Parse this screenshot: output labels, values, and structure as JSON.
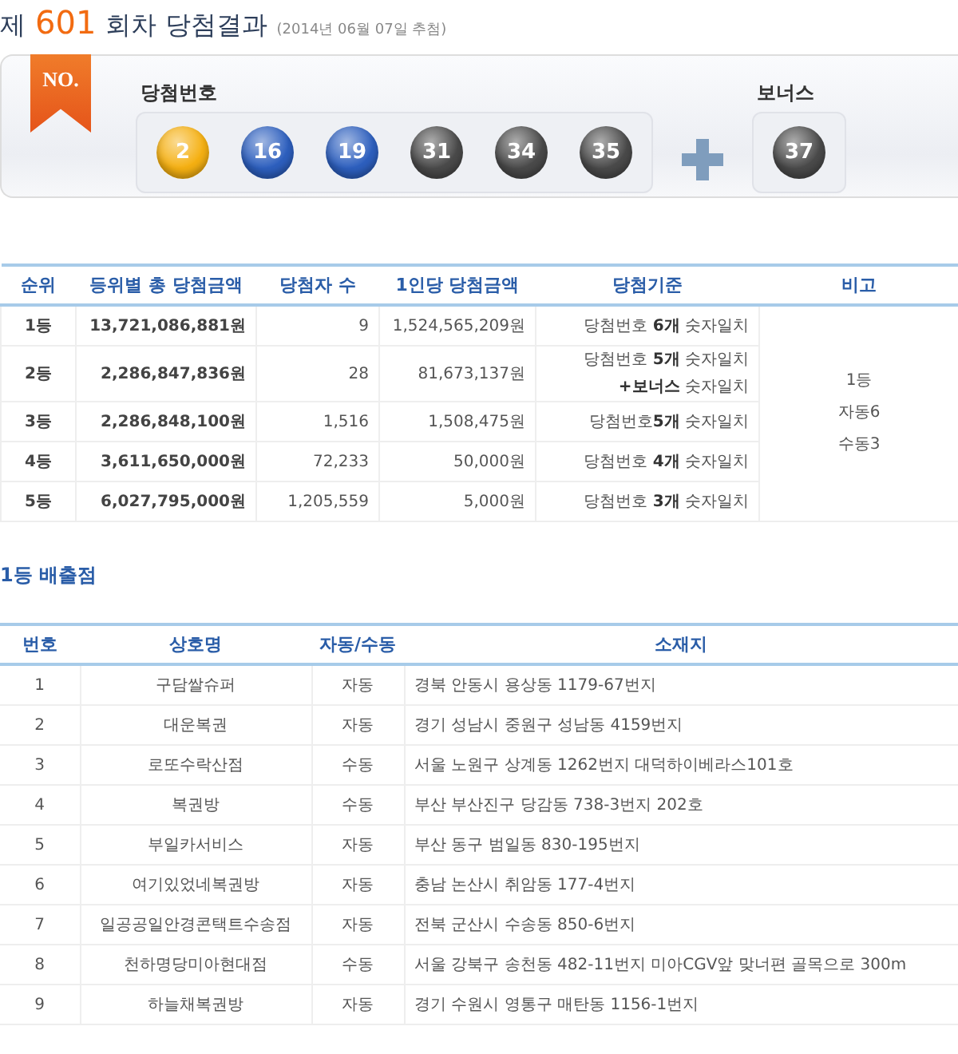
{
  "heading": {
    "prefix": "제",
    "round": "601",
    "suffix": "회차 당첨결과",
    "date": "(2014년 06월 07일 추첨)"
  },
  "draw_panel": {
    "badge": "NO.",
    "numbers_label": "당첨번호",
    "bonus_label": "보너스",
    "numbers": [
      {
        "number": "2",
        "color": "#f5b012"
      },
      {
        "number": "16",
        "color": "#2d5fbe"
      },
      {
        "number": "19",
        "color": "#2d5fbe"
      },
      {
        "number": "31",
        "color": "#4a4a4a"
      },
      {
        "number": "34",
        "color": "#4a4a4a"
      },
      {
        "number": "35",
        "color": "#4a4a4a"
      }
    ],
    "bonus": {
      "number": "37",
      "color": "#4a4a4a"
    }
  },
  "prize_table": {
    "columns": [
      "순위",
      "등위별 총 당첨금액",
      "당첨자 수",
      "1인당 당첨금액",
      "당첨기준",
      "비고"
    ],
    "rows": [
      {
        "rank": "1등",
        "total": "13,721,086,881원",
        "winners": "9",
        "per_person": "1,524,565,209원",
        "criteria": [
          "당첨번호 **6개** 숫자일치"
        ]
      },
      {
        "rank": "2등",
        "total": "2,286,847,836원",
        "winners": "28",
        "per_person": "81,673,137원",
        "criteria": [
          "당첨번호 **5개** 숫자일치",
          "**+보너스** 숫자일치"
        ]
      },
      {
        "rank": "3등",
        "total": "2,286,848,100원",
        "winners": "1,516",
        "per_person": "1,508,475원",
        "criteria": [
          "당첨번호**5개** 숫자일치"
        ]
      },
      {
        "rank": "4등",
        "total": "3,611,650,000원",
        "winners": "72,233",
        "per_person": "50,000원",
        "criteria": [
          "당첨번호 **4개** 숫자일치"
        ]
      },
      {
        "rank": "5등",
        "total": "6,027,795,000원",
        "winners": "1,205,559",
        "per_person": "5,000원",
        "criteria": [
          "당첨번호 **3개** 숫자일치"
        ]
      }
    ],
    "note": [
      "1등",
      "자동6",
      "수동3"
    ]
  },
  "stores_title": "1등 배출점",
  "stores_table": {
    "columns": [
      "번호",
      "상호명",
      "자동/수동",
      "소재지"
    ],
    "rows": [
      [
        "1",
        "구담쌀슈퍼",
        "자동",
        "경북 안동시 용상동 1179-67번지"
      ],
      [
        "2",
        "대운복권",
        "자동",
        "경기 성남시 중원구 성남동 4159번지"
      ],
      [
        "3",
        "로또수락산점",
        "수동",
        "서울 노원구 상계동 1262번지 대덕하이베라스101호"
      ],
      [
        "4",
        "복권방",
        "수동",
        "부산 부산진구 당감동 738-3번지 202호"
      ],
      [
        "5",
        "부일카서비스",
        "자동",
        "부산 동구 범일동 830-195번지"
      ],
      [
        "6",
        "여기있었네복권방",
        "자동",
        "충남 논산시 취암동 177-4번지"
      ],
      [
        "7",
        "일공공일안경콘택트수송점",
        "자동",
        "전북 군산시 수송동 850-6번지"
      ],
      [
        "8",
        "천하명당미아현대점",
        "수동",
        "서울 강북구 송천동 482-11번지 미아CGV앞 맞너편 골목으로 300m"
      ],
      [
        "9",
        "하늘채복권방",
        "자동",
        "경기 수원시 영통구 매탄동 1156-1번지"
      ]
    ]
  }
}
